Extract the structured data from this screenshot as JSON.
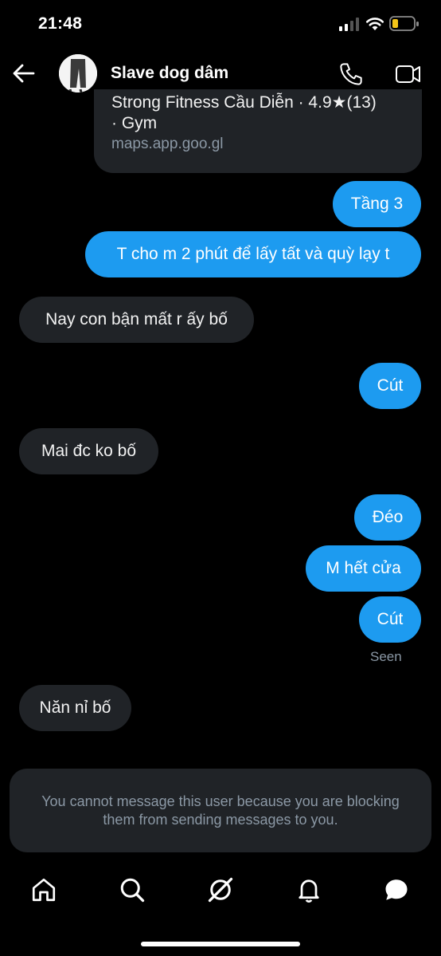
{
  "status": {
    "time": "21:48"
  },
  "header": {
    "title": "Slave dog dâm"
  },
  "link_card": {
    "line1": "Strong Fitness Cầu Diễn · 4.9★(13)",
    "line2": "· Gym",
    "url": "maps.app.goo.gl"
  },
  "messages": [
    {
      "dir": "out",
      "text": "Tầng 3"
    },
    {
      "dir": "out",
      "text": "T cho m 2 phút để lấy tất và quỳ lạy t"
    },
    {
      "dir": "in",
      "text": "Nay con bận mất r ấy bố"
    },
    {
      "dir": "out",
      "text": "Cút"
    },
    {
      "dir": "in",
      "text": "Mai đc ko bố"
    },
    {
      "dir": "out",
      "text": "Đéo"
    },
    {
      "dir": "out",
      "text": "M hết cửa"
    },
    {
      "dir": "out",
      "text": "Cút"
    },
    {
      "dir": "in",
      "text": "Năn nỉ bố"
    }
  ],
  "seen_label": "Seen",
  "blocked_notice": "You cannot message this user because you are blocking them from sending messages to you.",
  "colors": {
    "accent": "#1d9bf0",
    "bubble_in": "#202327",
    "background": "#000000",
    "battery": "#f5c518"
  },
  "nav": [
    "home-icon",
    "search-icon",
    "grok-icon",
    "notifications-icon",
    "messages-icon"
  ]
}
